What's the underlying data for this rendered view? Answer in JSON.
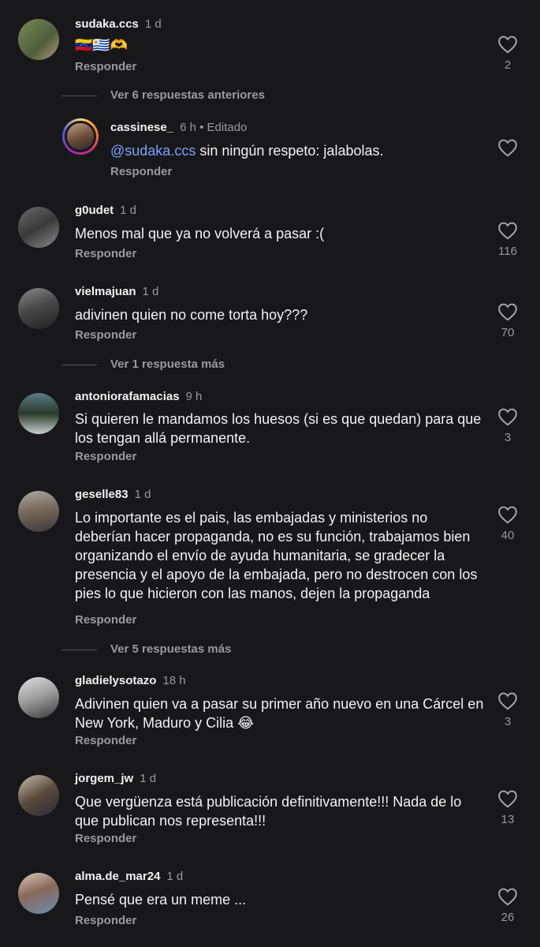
{
  "colors": {
    "background": "#18181b",
    "mention": "#7ea1ff",
    "muted": "#9a9a9a"
  },
  "reply_label": "Responder",
  "comments": [
    {
      "user": "sudaka.ccs",
      "time": "1 d",
      "text": "🇻🇪🇺🇾🫶",
      "likes": "2"
    },
    {
      "user": "cassinese_",
      "time": "6 h • Editado",
      "mention": "@sudaka.ccs",
      "text": " sin ningún respeto: jalabolas.",
      "likes": ""
    },
    {
      "user": "g0udet",
      "time": "1 d",
      "text": "Menos mal que ya no volverá a pasar :(",
      "likes": "116"
    },
    {
      "user": "vielmajuan",
      "time": "1 d",
      "text": "adivinen quien no come torta hoy???",
      "likes": "70"
    },
    {
      "user": "antoniorafamacias",
      "time": "9 h",
      "text": "Si quieren le mandamos los huesos (si es que quedan) para que los tengan allá permanente.",
      "likes": "3"
    },
    {
      "user": "geselle83",
      "time": "1 d",
      "text": "Lo importante es el pais, las embajadas y ministerios no deberían  hacer propaganda, no es su función, trabajamos bien organizando el envío de ayuda humanitaria, se gradecer la presencia y el apoyo de la embajada, pero no destrocen con los pies lo que hicieron con las manos, dejen la propaganda",
      "likes": "40"
    },
    {
      "user": "gladielysotazo",
      "time": "18 h",
      "text": "Adivinen quien va a pasar su primer año nuevo en una Cárcel en New York, Maduro y Cilia 😂",
      "likes": "3"
    },
    {
      "user": "jorgem_jw",
      "time": "1 d",
      "text": "Que vergüenza está publicación definitivamente!!! Nada de lo que publican nos representa!!!",
      "likes": "13"
    },
    {
      "user": "alma.de_mar24",
      "time": "1 d",
      "text": "Pensé que era un  meme ...",
      "likes": "26"
    }
  ],
  "more_replies": [
    {
      "label": "Ver 6 respuestas anteriores"
    },
    {
      "label": "Ver 1 respuesta más"
    },
    {
      "label": "Ver 5 respuestas más"
    }
  ]
}
